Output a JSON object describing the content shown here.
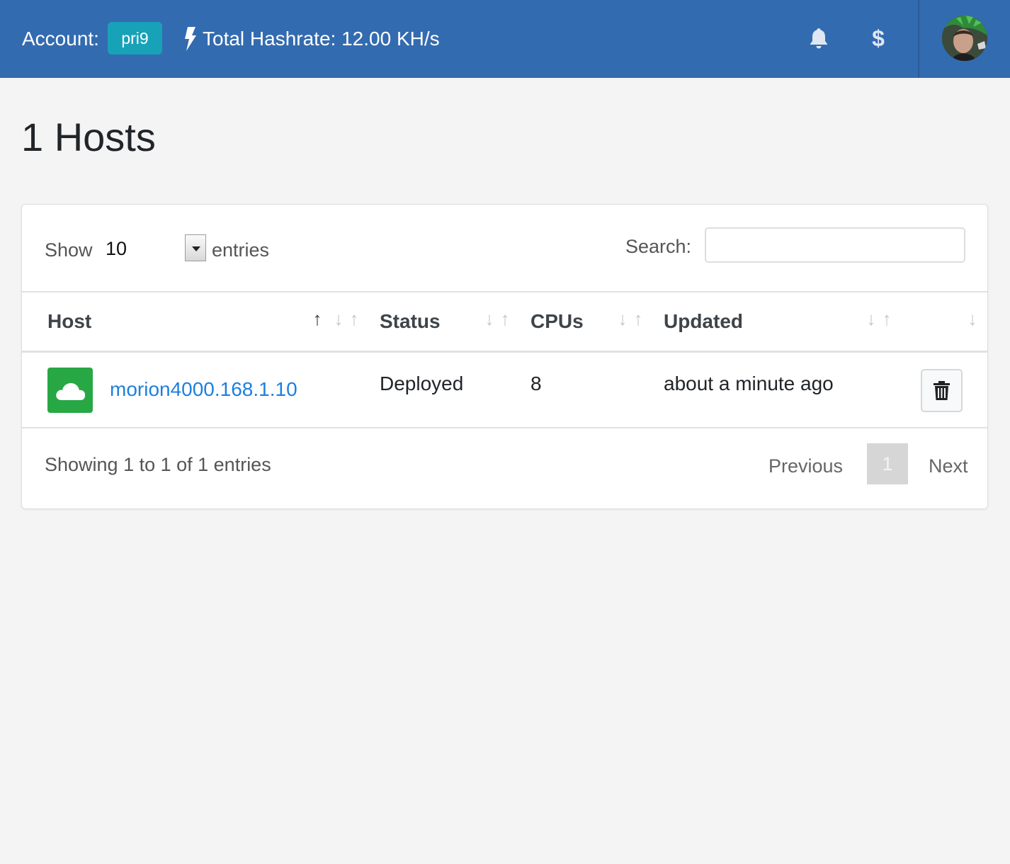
{
  "topbar": {
    "account_label": "Account:",
    "account_name": "pri9",
    "hashrate_text": "Total Hashrate: 12.00 KH/s",
    "brand_color": "#336bb0",
    "badge_color": "#17a2b8",
    "icons": [
      "bolt-icon",
      "bell-icon",
      "dollar-icon",
      "avatar"
    ],
    "dollar_glyph": "$"
  },
  "page": {
    "title": "1 Hosts"
  },
  "table_controls": {
    "show_label": "Show",
    "page_length": "10",
    "entries_label": "entries",
    "search_label": "Search:",
    "search_value": ""
  },
  "table": {
    "columns": [
      "Host",
      "Status",
      "CPUs",
      "Updated"
    ],
    "rows": [
      {
        "host": "morion4000.168.1.10",
        "status": "Deployed",
        "cpus": "8",
        "updated": "about a minute ago",
        "host_icon": "cloud-icon",
        "action_icon": "trash-icon"
      }
    ]
  },
  "footer": {
    "info": "Showing 1 to 1 of 1 entries",
    "previous": "Previous",
    "current_page": "1",
    "next": "Next"
  }
}
